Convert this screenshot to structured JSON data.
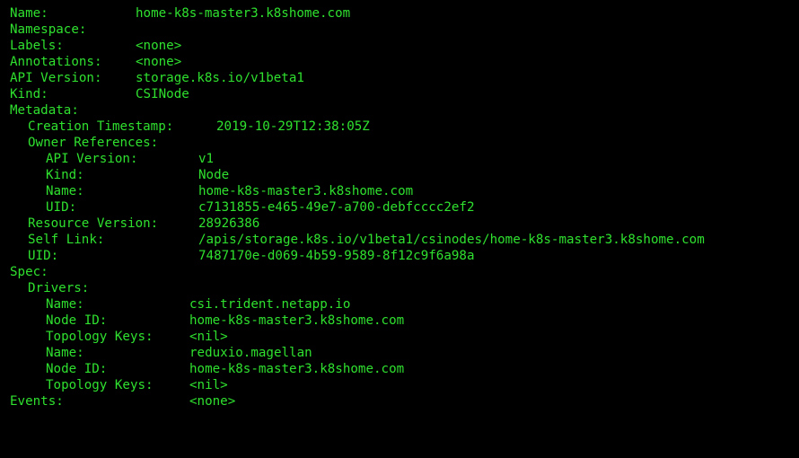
{
  "theme": {
    "background": "#000000",
    "foreground": "#2fe02f"
  },
  "lines": [
    {
      "key": "Name:",
      "value": "home-k8s-master3.k8shome.com"
    },
    {
      "key": "Namespace:",
      "value": ""
    },
    {
      "key": "Labels:",
      "value": "<none>"
    },
    {
      "key": "Annotations:",
      "value": "<none>"
    },
    {
      "key": "API Version:",
      "value": "storage.k8s.io/v1beta1"
    },
    {
      "key": "Kind:",
      "value": "CSINode"
    },
    {
      "key": "Metadata:",
      "value": ""
    },
    {
      "key": "Creation Timestamp:",
      "value": "2019-10-29T12:38:05Z"
    },
    {
      "key": "Owner References:",
      "value": ""
    },
    {
      "key": "API Version:",
      "value": "v1"
    },
    {
      "key": "Kind:",
      "value": "Node"
    },
    {
      "key": "Name:",
      "value": "home-k8s-master3.k8shome.com"
    },
    {
      "key": "UID:",
      "value": "c7131855-e465-49e7-a700-debfcccc2ef2"
    },
    {
      "key": "Resource Version:",
      "value": "28926386"
    },
    {
      "key": "Self Link:",
      "value": "/apis/storage.k8s.io/v1beta1/csinodes/home-k8s-master3.k8shome.com"
    },
    {
      "key": "UID:",
      "value": "7487170e-d069-4b59-9589-8f12c9f6a98a"
    },
    {
      "key": "Spec:",
      "value": ""
    },
    {
      "key": "Drivers:",
      "value": ""
    },
    {
      "key": "Name:",
      "value": "csi.trident.netapp.io"
    },
    {
      "key": "Node ID:",
      "value": "home-k8s-master3.k8shome.com"
    },
    {
      "key": "Topology Keys:",
      "value": "<nil>"
    },
    {
      "key": "Name:",
      "value": "reduxio.magellan"
    },
    {
      "key": "Node ID:",
      "value": "home-k8s-master3.k8shome.com"
    },
    {
      "key": "Topology Keys:",
      "value": "<nil>"
    },
    {
      "key": "Events:",
      "value": "<none>"
    }
  ]
}
